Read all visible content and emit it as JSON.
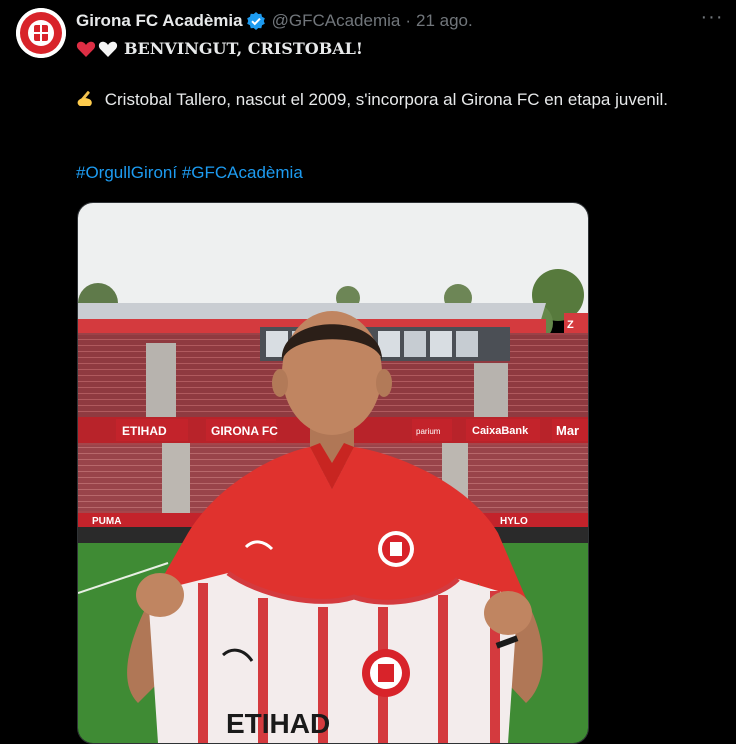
{
  "tweet": {
    "display_name": "Girona FC Acadèmia",
    "handle": "@GFCAcademia",
    "separator": "·",
    "date": "21 ago.",
    "headline": "BENVINGUT, CRISTOBAL!",
    "body": "Cristobal Tallero, nascut el 2009, s'incorpora al Girona FC en etapa juvenil.",
    "hashtags": [
      "#OrgullGironí",
      "#GFCAcadèmia"
    ]
  },
  "media": {
    "signs": [
      "ETIHAD",
      "GIRONA FC",
      "CaixaBank",
      "Mar",
      "parium",
      "HYLO",
      "PUMA"
    ],
    "shirt_sponsor": "ETIHAD"
  },
  "icons": {
    "verified": "verified-badge-icon",
    "more": "more-options-icon",
    "hearts": [
      "red-heart-icon",
      "white-heart-icon"
    ],
    "pen": "writing-hand-icon"
  },
  "colors": {
    "accent": "#1d9bf0",
    "muted": "#71767b",
    "text": "#e7e9ea",
    "girona_red": "#d8232a"
  }
}
